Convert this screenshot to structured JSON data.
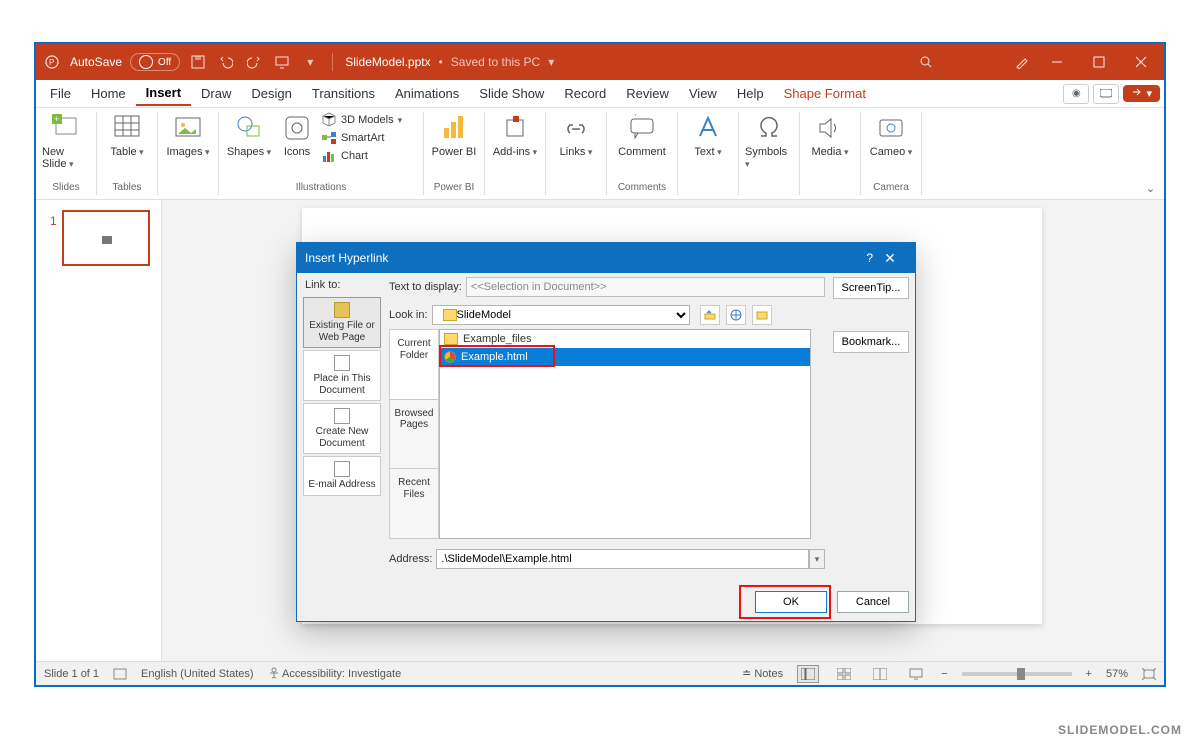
{
  "titlebar": {
    "autosave_label": "AutoSave",
    "autosave_state": "Off",
    "filename": "SlideModel.pptx",
    "save_status": "Saved to this PC"
  },
  "tabs": {
    "items": [
      "File",
      "Home",
      "Insert",
      "Draw",
      "Design",
      "Transitions",
      "Animations",
      "Slide Show",
      "Record",
      "Review",
      "View",
      "Help",
      "Shape Format"
    ],
    "active": "Insert"
  },
  "share_label": "",
  "ribbon": {
    "new_slide": "New Slide",
    "table": "Table",
    "images": "Images",
    "shapes": "Shapes",
    "icons": "Icons",
    "models3d": "3D Models",
    "smartart": "SmartArt",
    "chart": "Chart",
    "powerbi": "Power BI",
    "addins": "Add-ins",
    "links": "Links",
    "comment": "Comment",
    "text": "Text",
    "symbols": "Symbols",
    "media": "Media",
    "cameo": "Cameo",
    "group_slides": "Slides",
    "group_tables": "Tables",
    "group_illus": "Illustrations",
    "group_powerbi": "Power BI",
    "group_comments": "Comments",
    "group_camera": "Camera"
  },
  "thumbs": {
    "slide1_num": "1"
  },
  "dialog": {
    "title": "Insert Hyperlink",
    "linkto_label": "Link to:",
    "text_to_display_label": "Text to display:",
    "text_to_display_value": "<<Selection in Document>>",
    "screentip": "ScreenTip...",
    "bookmark": "Bookmark...",
    "lookin_label": "Look in:",
    "lookin_value": "SlideModel",
    "nav": {
      "existing": "Existing File or Web Page",
      "place": "Place in This Document",
      "createnew": "Create New Document",
      "email": "E-mail Address"
    },
    "browse_tabs": {
      "current": "Current Folder",
      "browsed": "Browsed Pages",
      "recent": "Recent Files"
    },
    "files": {
      "folder": "Example_files",
      "html": "Example.html"
    },
    "address_label": "Address:",
    "address_value": ".\\SlideModel\\Example.html",
    "ok": "OK",
    "cancel": "Cancel"
  },
  "statusbar": {
    "slide": "Slide 1 of 1",
    "lang": "English (United States)",
    "access": "Accessibility: Investigate",
    "notes": "Notes",
    "zoom": "57%"
  },
  "watermark": "SLIDEMODEL.COM"
}
